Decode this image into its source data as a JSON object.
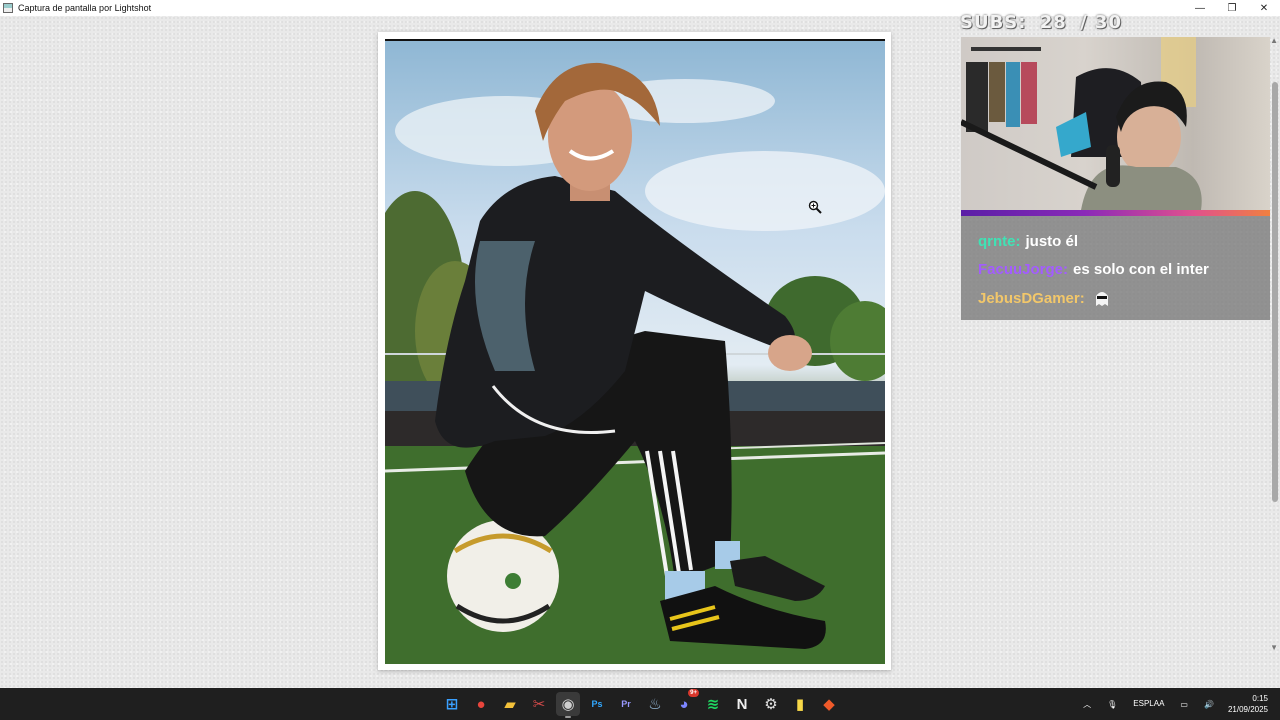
{
  "window": {
    "title": "Captura de pantalla por Lightshot",
    "minimize": "—",
    "maximize": "❐",
    "close": "✕"
  },
  "overlay": {
    "subs_label": "SUBS:",
    "subs_current": "28",
    "subs_goal": "/ 30",
    "chat": [
      {
        "user": "qrnte:",
        "message": "justo él",
        "user_color": "#3fe3b5"
      },
      {
        "user": "FacuuJorge:",
        "message": "es solo con el inter",
        "user_color": "#a35cff"
      },
      {
        "user": "JebusDGamer:",
        "message": "",
        "user_color": "#f2c76a",
        "emote": "sunglasses-ghost-emote"
      }
    ]
  },
  "taskbar": {
    "apps": [
      {
        "name": "start-button",
        "glyph": "⊞",
        "color": "#3aa0ff"
      },
      {
        "name": "chrome-icon",
        "glyph": "●",
        "color": "#e8453c"
      },
      {
        "name": "file-explorer-icon",
        "glyph": "▰",
        "color": "#f3c13a"
      },
      {
        "name": "snipping-tool-icon",
        "glyph": "✂",
        "color": "#d14a4a"
      },
      {
        "name": "obs-icon",
        "glyph": "◉",
        "color": "#cfcfcf",
        "active": true
      },
      {
        "name": "photoshop-icon",
        "glyph": "Ps",
        "color": "#31a8ff"
      },
      {
        "name": "premiere-icon",
        "glyph": "Pr",
        "color": "#9999ff"
      },
      {
        "name": "steam-icon",
        "glyph": "♨",
        "color": "#9fc6e6"
      },
      {
        "name": "discord-icon",
        "glyph": "◕",
        "color": "#7d86ff",
        "badge": "9+"
      },
      {
        "name": "spotify-icon",
        "glyph": "≋",
        "color": "#1ed760"
      },
      {
        "name": "notion-icon",
        "glyph": "N",
        "color": "#f0f0f0"
      },
      {
        "name": "settings-icon",
        "glyph": "⚙",
        "color": "#e0e0e0"
      },
      {
        "name": "sticky-notes-icon",
        "glyph": "▮",
        "color": "#f7d848"
      },
      {
        "name": "game-launcher-icon",
        "glyph": "◆",
        "color": "#ef5a2a"
      }
    ],
    "lang_top": "ESP",
    "lang_bottom": "LAA",
    "time": "0:15",
    "date": "21/09/2025"
  }
}
